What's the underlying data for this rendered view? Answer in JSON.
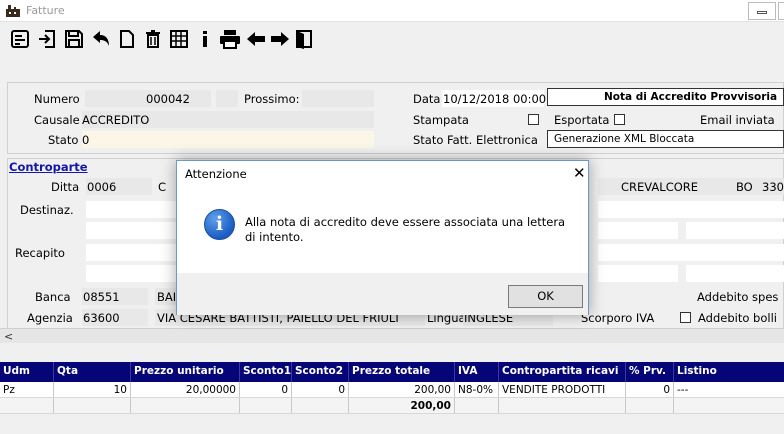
{
  "window": {
    "title": "Fatture"
  },
  "header": {
    "numero_label": "Numero",
    "numero_value": "000042",
    "prossimo_label": "Prossimo:",
    "data_label": "Data",
    "data_value": "10/12/2018 00:00",
    "nota_title": "Nota di Accredito Provvisoria",
    "causale_label": "Causale",
    "causale_value": "ACCREDITO",
    "stampata_label": "Stampata",
    "esportata_label": "Esportata",
    "email_label": "Email inviata",
    "stato_label": "Stato",
    "stato_value": "0",
    "stato_fatt_label": "Stato Fatt. Elettronica",
    "stato_fatt_value": "Generazione XML Bloccata"
  },
  "controparte": {
    "title": "Controparte",
    "ditta_label": "Ditta",
    "ditta_value": "0006",
    "ditta_partial": "C",
    "city": "CREVALCORE",
    "prov": "BO",
    "cap": "330",
    "destinaz_label": "Destinaz.",
    "recapito_label": "Recapito",
    "banca_label": "Banca",
    "banca_value": "08551",
    "banca_desc": "BAI",
    "addebito_spese_label": "Addebito spes",
    "agenzia_label": "Agenzia",
    "agenzia_value": "63600",
    "agenzia_desc": "VIA CESARE BATTISTI, PAIELLO DEL FRIULI",
    "lingua_label": "Lingua",
    "lingua_value": "INGLESE",
    "scorporo_label": "Scorporo IVA",
    "addebito_bolli_label": "Addebito bolli"
  },
  "grid": {
    "columns": [
      "Udm",
      "Qta",
      "Prezzo unitario",
      "Sconto1",
      "Sconto2",
      "Prezzo totale",
      "IVA",
      "Contropartita ricavi",
      "% Prv.",
      "Listino"
    ],
    "rows": [
      [
        "Pz",
        "10",
        "20,00000",
        "0",
        "0",
        "200,00",
        "N8-0%",
        "VENDITE PRODOTTI",
        "0",
        "---"
      ]
    ],
    "total": "200,00"
  },
  "dialog": {
    "title": "Attenzione",
    "message": "Alla nota di accredito deve essere associata una lettera di intento.",
    "ok_label": "OK",
    "icon": "info-icon"
  },
  "toolbar": {
    "icons": [
      "form-icon",
      "login-icon",
      "save-icon",
      "undo-icon",
      "new-document-icon",
      "trash-icon",
      "grid-icon",
      "info-icon",
      "print-icon",
      "arrow-left-icon",
      "arrow-right-icon",
      "exit-icon"
    ]
  },
  "colors": {
    "grid_header": "#050578",
    "link": "#1515a6",
    "dialog_border": "#6b9ac8"
  }
}
